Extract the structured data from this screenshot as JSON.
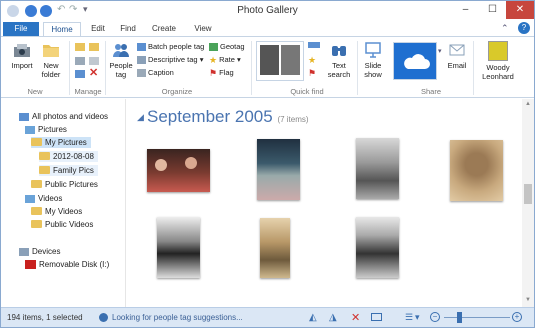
{
  "window": {
    "title": "Photo Gallery",
    "minimize": "–",
    "maximize": "☐",
    "close": "✕",
    "help": "?",
    "collapse": "⌃"
  },
  "tabs": [
    "File",
    "Home",
    "Edit",
    "Find",
    "Create",
    "View"
  ],
  "ribbon": {
    "new_group": {
      "import": "Import",
      "new_folder": "New\nfolder",
      "label": "New"
    },
    "manage_label": "Manage",
    "organize": {
      "people_tag": "People\ntag",
      "batch_people_tag": "Batch people tag",
      "descriptive_tag": "Descriptive tag",
      "caption": "Caption",
      "geotag": "Geotag",
      "rate": "Rate",
      "flag": "Flag",
      "label": "Organize"
    },
    "quick_find": {
      "text_search": "Text\nsearch",
      "label": "Quick find"
    },
    "share": {
      "slide_show": "Slide\nshow",
      "email": "Email",
      "label": "Share"
    },
    "account": {
      "name": "Woody\nLeonhard"
    }
  },
  "tree": {
    "all": "All photos and videos",
    "pictures": "Pictures",
    "my_pictures": "My Pictures",
    "folder1": "2012-08-08",
    "folder2": "Family Pics",
    "public_pictures": "Public Pictures",
    "videos": "Videos",
    "my_videos": "My Videos",
    "public_videos": "Public Videos",
    "devices": "Devices",
    "removable": "Removable Disk (I:)"
  },
  "content": {
    "heading": "September 2005",
    "count": "(7 items)"
  },
  "status": {
    "selection": "194 items, 1 selected",
    "message": "Looking for people tag suggestions..."
  },
  "colors": {
    "accent": "#2a74c4",
    "heading": "#4a74b0",
    "status_bg": "#dbe7f5"
  }
}
